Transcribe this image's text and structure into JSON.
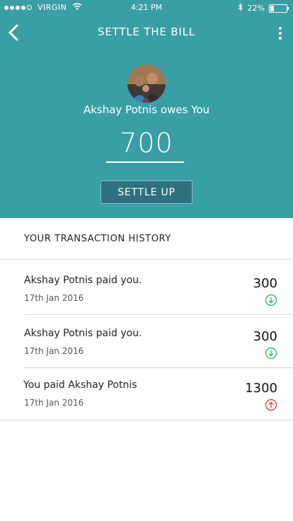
{
  "status": {
    "carrier": "VIRGIN",
    "time": "4:21 PM",
    "battery": "22%"
  },
  "header": {
    "title": "SETTLE THE BILL",
    "owes_text": "Akshay Potnis owes You",
    "amount": "700",
    "settle_label": "SETTLE UP"
  },
  "history": {
    "title": "YOUR TRANSACTION HISTORY",
    "items": [
      {
        "text": "Akshay Potnis paid you.",
        "date": "17th Jan 2016",
        "amount": "300",
        "direction": "in"
      },
      {
        "text": "Akshay Potnis paid you.",
        "date": "17th Jan 2016",
        "amount": "300",
        "direction": "in"
      },
      {
        "text": "You paid Akshay Potnis",
        "date": "17th Jan 2016",
        "amount": "1300",
        "direction": "out"
      }
    ]
  },
  "colors": {
    "header_bg": "#3a9ea6",
    "in": "#3bb66b",
    "out": "#e04444"
  },
  "icons": [
    "back-arrow-icon",
    "more-options-icon",
    "arrow-down-circle-icon",
    "arrow-up-circle-icon"
  ]
}
